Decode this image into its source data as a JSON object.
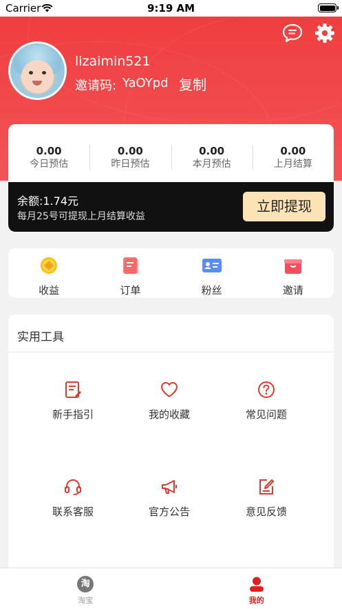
{
  "status_bar": {
    "carrier": "Carrier",
    "time": "9:19 AM"
  },
  "profile": {
    "username": "lizaimin521",
    "invite_label": "邀请码:",
    "invite_code": "YaOYpd",
    "copy_label": "复制"
  },
  "stats": [
    {
      "value": "0.00",
      "label": "今日预估"
    },
    {
      "value": "0.00",
      "label": "昨日预估"
    },
    {
      "value": "0.00",
      "label": "本月预估"
    },
    {
      "value": "0.00",
      "label": "上月结算"
    }
  ],
  "balance": {
    "amount_text": "余额:1.74元",
    "note": "每月25号可提现上月结算收益",
    "withdraw_label": "立即提现"
  },
  "quick_links": [
    {
      "label": "收益",
      "icon": "coin-icon"
    },
    {
      "label": "订单",
      "icon": "order-icon"
    },
    {
      "label": "粉丝",
      "icon": "fans-icon"
    },
    {
      "label": "邀请",
      "icon": "gift-icon"
    }
  ],
  "tools": {
    "title": "实用工具",
    "items": [
      {
        "label": "新手指引",
        "icon": "guide-icon"
      },
      {
        "label": "我的收藏",
        "icon": "heart-icon"
      },
      {
        "label": "常见问题",
        "icon": "question-icon"
      },
      {
        "label": "联系客服",
        "icon": "headset-icon"
      },
      {
        "label": "官方公告",
        "icon": "megaphone-icon"
      },
      {
        "label": "意见反馈",
        "icon": "feedback-icon"
      }
    ]
  },
  "tabbar": [
    {
      "label": "淘宝",
      "icon": "taobao-icon",
      "glyph": "淘",
      "active": false
    },
    {
      "label": "我的",
      "icon": "profile-icon",
      "active": true
    }
  ],
  "colors": {
    "brand_red": "#ee3b3d",
    "icon_red": "#e03a2f",
    "gold_button": "#fbe3b6",
    "tab_inactive": "#999999",
    "tab_active": "#e02020"
  }
}
